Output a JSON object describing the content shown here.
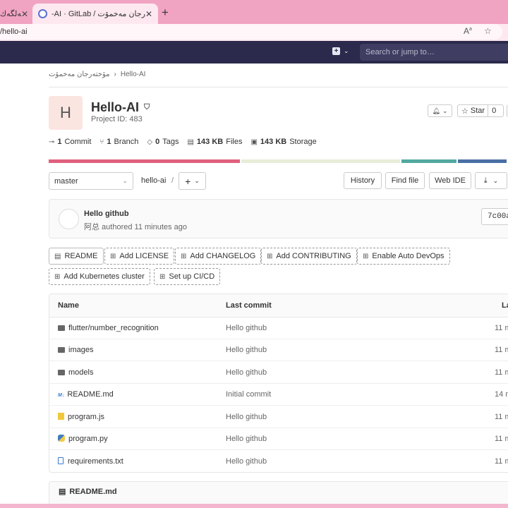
{
  "browser": {
    "inactive_tab": {
      "label": "تەلگەك"
    },
    "active_tab": {
      "label": "-AI · GitLab / مۆختەرجان مەخمۆت"
    },
    "url": "/hello-ai"
  },
  "header": {
    "search_placeholder": "Search or jump to…"
  },
  "breadcrumb": {
    "group": "مۆختەرجان مەخمۆت",
    "separator": "›",
    "project": "Hello-AI"
  },
  "project": {
    "avatar_letter": "H",
    "title": "Hello-AI",
    "id_text": "Project ID: 483",
    "star_label": "Star",
    "star_count": "0"
  },
  "stats": [
    {
      "value": "1",
      "label": "Commit",
      "icon": "commit-icon"
    },
    {
      "value": "1",
      "label": "Branch",
      "icon": "branch-icon"
    },
    {
      "value": "0",
      "label": "Tags",
      "icon": "tag-icon"
    },
    {
      "value": "143 KB",
      "label": "Files",
      "icon": "file-icon"
    },
    {
      "value": "143 KB",
      "label": "Storage",
      "icon": "storage-icon"
    }
  ],
  "languages": [
    {
      "color": "#e0607e",
      "share": 0.422
    },
    {
      "color": "#e8edd9",
      "share": 0.35
    },
    {
      "color": "#52a9a0",
      "share": 0.12
    },
    {
      "color": "#4a6fa5",
      "share": 0.108
    }
  ],
  "repo_nav": {
    "branch": "master",
    "path_root": "hello-ai",
    "path_sep": "/",
    "history": "History",
    "find_file": "Find file",
    "web_ide": "Web IDE"
  },
  "last_commit": {
    "title": "Hello github",
    "author_line": "阿总 authored 11 minutes ago",
    "sha": "7c00a"
  },
  "quick_actions": [
    {
      "label": "README",
      "icon": "file-icon",
      "dashed": false
    },
    {
      "label": "Add LICENSE",
      "icon": "plus-square-icon",
      "dashed": true
    },
    {
      "label": "Add CHANGELOG",
      "icon": "plus-square-icon",
      "dashed": true
    },
    {
      "label": "Add CONTRIBUTING",
      "icon": "plus-square-icon",
      "dashed": true
    },
    {
      "label": "Enable Auto DevOps",
      "icon": "plus-square-icon",
      "dashed": true
    },
    {
      "label": "Add Kubernetes cluster",
      "icon": "plus-square-icon",
      "dashed": true
    },
    {
      "label": "Set up CI/CD",
      "icon": "plus-square-icon",
      "dashed": true
    }
  ],
  "file_table": {
    "columns": [
      "Name",
      "Last commit",
      "La"
    ],
    "rows": [
      {
        "name": "flutter/number_recognition",
        "type": "folder",
        "commit": "Hello github",
        "time": "11 m"
      },
      {
        "name": "images",
        "type": "folder",
        "commit": "Hello github",
        "time": "11 m"
      },
      {
        "name": "models",
        "type": "folder",
        "commit": "Hello github",
        "time": "11 m"
      },
      {
        "name": "README.md",
        "type": "markdown",
        "commit": "Initial commit",
        "time": "14 m"
      },
      {
        "name": "program.js",
        "type": "js",
        "commit": "Hello github",
        "time": "11 m"
      },
      {
        "name": "program.py",
        "type": "python",
        "commit": "Hello github",
        "time": "11 m"
      },
      {
        "name": "requirements.txt",
        "type": "text",
        "commit": "Hello github",
        "time": "11 m"
      }
    ]
  },
  "readme": {
    "title": "README.md"
  }
}
